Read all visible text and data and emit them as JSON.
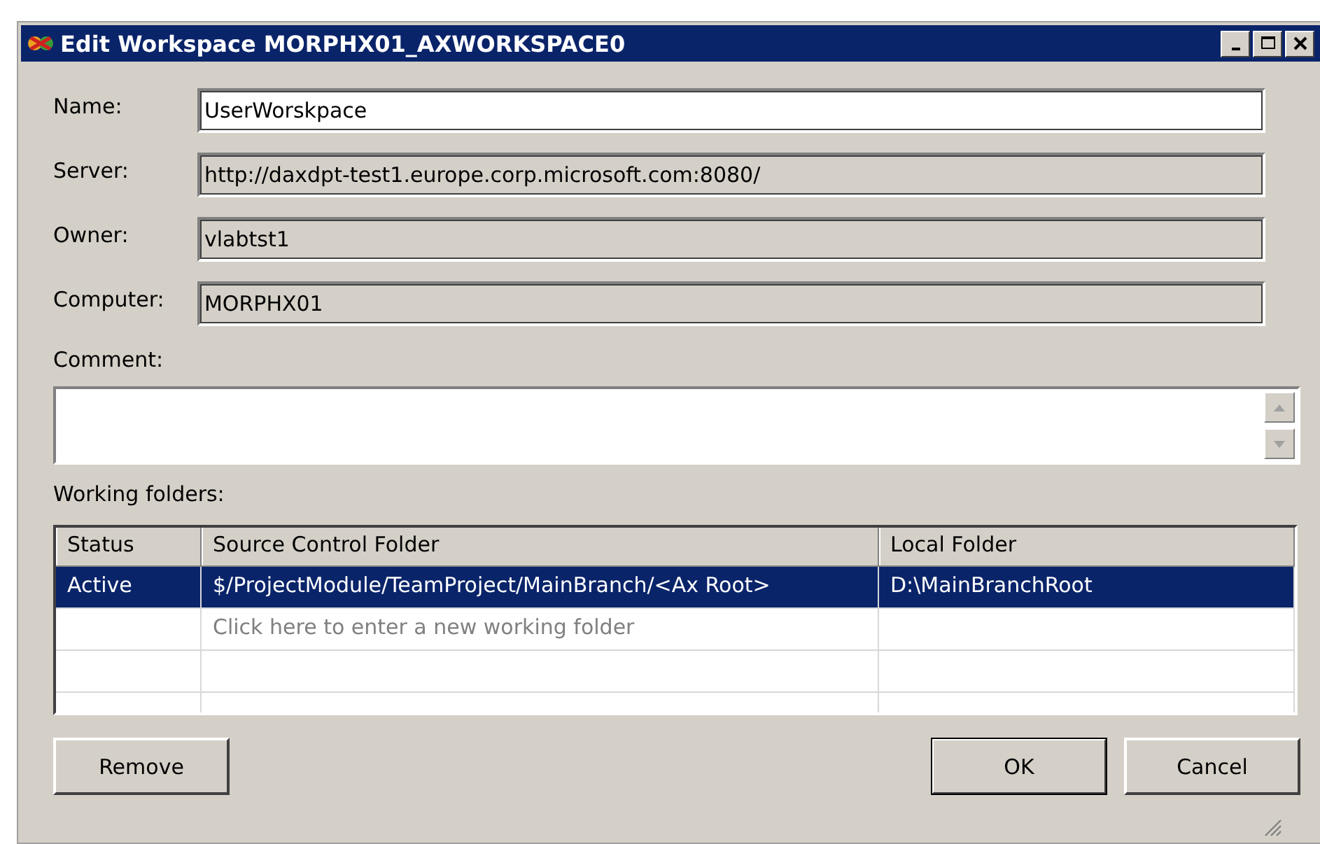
{
  "window": {
    "title": "Edit Workspace MORPHX01_AXWORKSPACE0"
  },
  "fields": [
    {
      "label": "Name:",
      "value": "UserWorskpace",
      "readonly": false
    },
    {
      "label": "Server:",
      "value": "http://daxdpt-test1.europe.corp.microsoft.com:8080/",
      "readonly": true
    },
    {
      "label": "Owner:",
      "value": "vlabtst1",
      "readonly": true
    },
    {
      "label": "Computer:",
      "value": "MORPHX01",
      "readonly": true
    }
  ],
  "comment": {
    "label": "Comment:"
  },
  "working_folders": {
    "label": "Working folders:",
    "columns": [
      "Status",
      "Source Control Folder",
      "Local Folder"
    ],
    "rows": [
      {
        "kind": "entry",
        "selected": true,
        "cells": [
          "Active",
          "$/ProjectModule/TeamProject/MainBranch/<Ax Root>",
          "D:\\MainBranchRoot"
        ]
      },
      {
        "kind": "new",
        "selected": false,
        "placeholder": "Click here to enter a new working folder"
      }
    ]
  },
  "buttons": [
    {
      "label": "Remove",
      "default": false
    },
    {
      "label": "OK",
      "default": true
    },
    {
      "label": "Cancel",
      "default": false
    }
  ]
}
